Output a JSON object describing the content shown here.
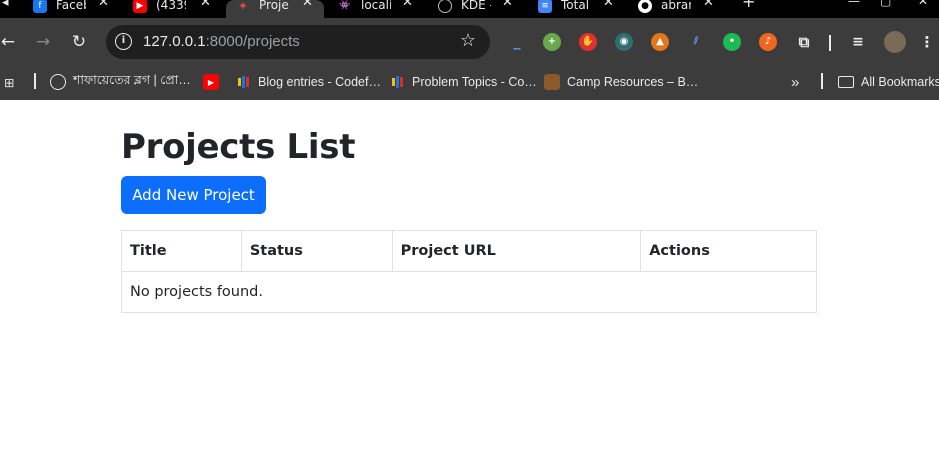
{
  "browser": {
    "tabs": [
      {
        "title": "Faceb",
        "icon": "facebook-icon",
        "color": "#1877f2"
      },
      {
        "title": "(4339",
        "icon": "youtube-icon",
        "color": "#ff0000"
      },
      {
        "title": "Proje",
        "icon": "laravel-icon",
        "color": "#f05340"
      },
      {
        "title": "locali",
        "icon": "invader-icon",
        "color": "#d0d0d0"
      },
      {
        "title": "KDE -",
        "icon": "globe-icon",
        "color": "#bbbbbb"
      },
      {
        "title": "Total",
        "icon": "docs-icon",
        "color": "#4285f4"
      },
      {
        "title": "abrar",
        "icon": "github-icon",
        "color": "#ffffff"
      }
    ],
    "new_tab": "+",
    "address_host": "127.0.0.1",
    "address_rest": ":8000/projects",
    "bookmarks": [
      {
        "label": "শাফায়েতের ব্লগ | প্রো…",
        "icon": "globe-icon"
      },
      {
        "label": "",
        "icon": "youtube-icon"
      },
      {
        "label": "Blog entries - Codef…",
        "icon": "codeforces-icon"
      },
      {
        "label": "Problem Topics - Co…",
        "icon": "codeforces-icon"
      },
      {
        "label": "Camp Resources – B…",
        "icon": "camp-icon"
      }
    ],
    "more_bookmarks": "»",
    "all_bookmarks": "All Bookmarks"
  },
  "page": {
    "title": "Projects List",
    "add_button": "Add New Project",
    "table": {
      "headers": [
        "Title",
        "Status",
        "Project URL",
        "Actions"
      ],
      "empty_message": "No projects found."
    }
  },
  "colors": {
    "primary": "#0d6efd",
    "chrome_dark": "#3c3c3c",
    "tabstrip": "#000000"
  }
}
